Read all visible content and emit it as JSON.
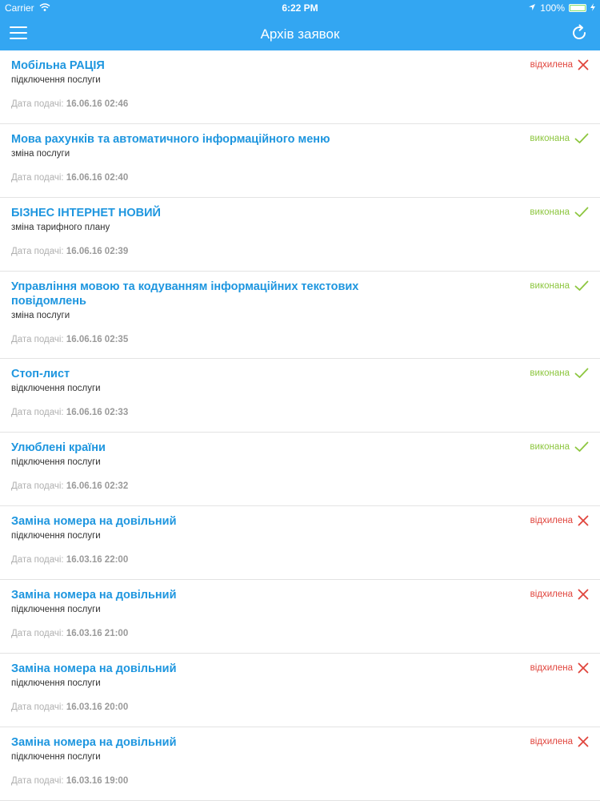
{
  "statusbar": {
    "carrier": "Carrier",
    "time": "6:22 PM",
    "battery": "100%",
    "battery_level": 1.0
  },
  "navbar": {
    "title": "Архів заявок"
  },
  "colors": {
    "header": "#33a6f2",
    "title": "#1e96df",
    "rejected": "#e0443c",
    "done": "#8dc63f"
  },
  "requests": [
    {
      "title": "Мобільна РАЦІЯ",
      "subtitle": "підключення послуги",
      "date_label": "Дата подачі:",
      "date": "16.06.16 02:46",
      "status": "відхилена",
      "status_type": "rejected",
      "status_icon": "x-icon"
    },
    {
      "title": "Мова рахунків та автоматичного інформаційного меню",
      "subtitle": "зміна послуги",
      "date_label": "Дата подачі:",
      "date": "16.06.16 02:40",
      "status": "виконана",
      "status_type": "done",
      "status_icon": "check-icon"
    },
    {
      "title": "БІЗНЕС ІНТЕРНЕТ НОВИЙ",
      "subtitle": "зміна тарифного плану",
      "date_label": "Дата подачі:",
      "date": "16.06.16 02:39",
      "status": "виконана",
      "status_type": "done",
      "status_icon": "check-icon"
    },
    {
      "title": "Управління мовою та кодуванням інформаційних текстових повідомлень",
      "subtitle": "зміна послуги",
      "date_label": "Дата подачі:",
      "date": "16.06.16 02:35",
      "status": "виконана",
      "status_type": "done",
      "status_icon": "check-icon"
    },
    {
      "title": "Стоп-лист",
      "subtitle": "відключення послуги",
      "date_label": "Дата подачі:",
      "date": "16.06.16 02:33",
      "status": "виконана",
      "status_type": "done",
      "status_icon": "check-icon"
    },
    {
      "title": "Улюблені країни",
      "subtitle": "підключення послуги",
      "date_label": "Дата подачі:",
      "date": "16.06.16 02:32",
      "status": "виконана",
      "status_type": "done",
      "status_icon": "check-icon"
    },
    {
      "title": "Заміна номера на довільний",
      "subtitle": "підключення послуги",
      "date_label": "Дата подачі:",
      "date": "16.03.16 22:00",
      "status": "відхилена",
      "status_type": "rejected",
      "status_icon": "x-icon"
    },
    {
      "title": "Заміна номера на довільний",
      "subtitle": "підключення послуги",
      "date_label": "Дата подачі:",
      "date": "16.03.16 21:00",
      "status": "відхилена",
      "status_type": "rejected",
      "status_icon": "x-icon"
    },
    {
      "title": "Заміна номера на довільний",
      "subtitle": "підключення послуги",
      "date_label": "Дата подачі:",
      "date": "16.03.16 20:00",
      "status": "відхилена",
      "status_type": "rejected",
      "status_icon": "x-icon"
    },
    {
      "title": "Заміна номера на довільний",
      "subtitle": "підключення послуги",
      "date_label": "Дата подачі:",
      "date": "16.03.16 19:00",
      "status": "відхилена",
      "status_type": "rejected",
      "status_icon": "x-icon"
    }
  ]
}
